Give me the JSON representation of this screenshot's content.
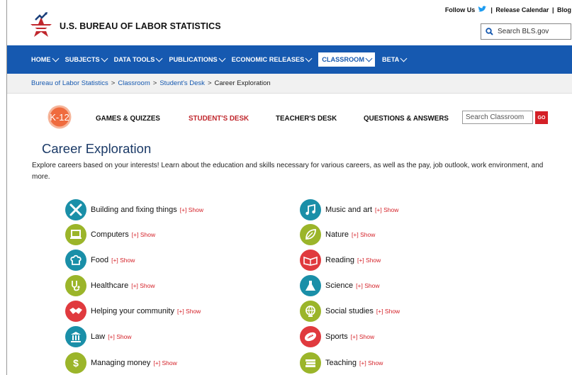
{
  "header": {
    "site_title": "U.S. BUREAU OF LABOR STATISTICS",
    "follow_us": "Follow Us",
    "release_calendar": "Release Calendar",
    "blog": "Blog",
    "search_placeholder": "Search BLS.gov"
  },
  "nav": {
    "home": "HOME",
    "subjects": "SUBJECTS",
    "data_tools": "DATA TOOLS",
    "publications": "PUBLICATIONS",
    "economic_releases": "ECONOMIC RELEASES",
    "classroom": "CLASSROOM",
    "beta": "BETA"
  },
  "breadcrumb": {
    "item1": "Bureau of Labor Statistics",
    "item2": "Classroom",
    "item3": "Student's Desk",
    "current": "Career Exploration",
    "sep": ">"
  },
  "subnav": {
    "k12": "K-12",
    "games": "GAMES & QUIZZES",
    "students": "STUDENT'S DESK",
    "teachers": "TEACHER'S DESK",
    "qa": "QUESTIONS & ANSWERS",
    "search_placeholder": "Search Classroom",
    "go": "GO"
  },
  "page": {
    "title": "Career Exploration",
    "intro": "Explore careers based on your interests! Learn about the education and skills necessary for various careers, as well as the pay, job outlook, work environment, and more."
  },
  "careers": {
    "show_label": "[+] Show",
    "left": [
      {
        "name": "Building and fixing things",
        "icon": "tools-icon",
        "color": "#1a8fa8"
      },
      {
        "name": "Computers",
        "icon": "computer-icon",
        "color": "#9bb52a"
      },
      {
        "name": "Food",
        "icon": "chef-hat-icon",
        "color": "#1a8fa8"
      },
      {
        "name": "Healthcare",
        "icon": "stethoscope-icon",
        "color": "#9bb52a"
      },
      {
        "name": "Helping your community",
        "icon": "handshake-icon",
        "color": "#e03a3e"
      },
      {
        "name": "Law",
        "icon": "courthouse-icon",
        "color": "#1a8fa8"
      },
      {
        "name": "Managing money",
        "icon": "money-icon",
        "color": "#9bb52a"
      }
    ],
    "right": [
      {
        "name": "Music and art",
        "icon": "music-icon",
        "color": "#1a8fa8"
      },
      {
        "name": "Nature",
        "icon": "leaf-icon",
        "color": "#9bb52a"
      },
      {
        "name": "Reading",
        "icon": "book-icon",
        "color": "#e03a3e"
      },
      {
        "name": "Science",
        "icon": "flask-icon",
        "color": "#1a8fa8"
      },
      {
        "name": "Social studies",
        "icon": "globe-icon",
        "color": "#9bb52a"
      },
      {
        "name": "Sports",
        "icon": "football-icon",
        "color": "#e03a3e"
      },
      {
        "name": "Teaching",
        "icon": "books-icon",
        "color": "#9bb52a"
      }
    ]
  },
  "colors": {
    "nav_blue": "#1659b0",
    "red": "#d42027",
    "teal": "#1a8fa8",
    "green": "#9bb52a",
    "title_blue": "#1b3a67"
  }
}
